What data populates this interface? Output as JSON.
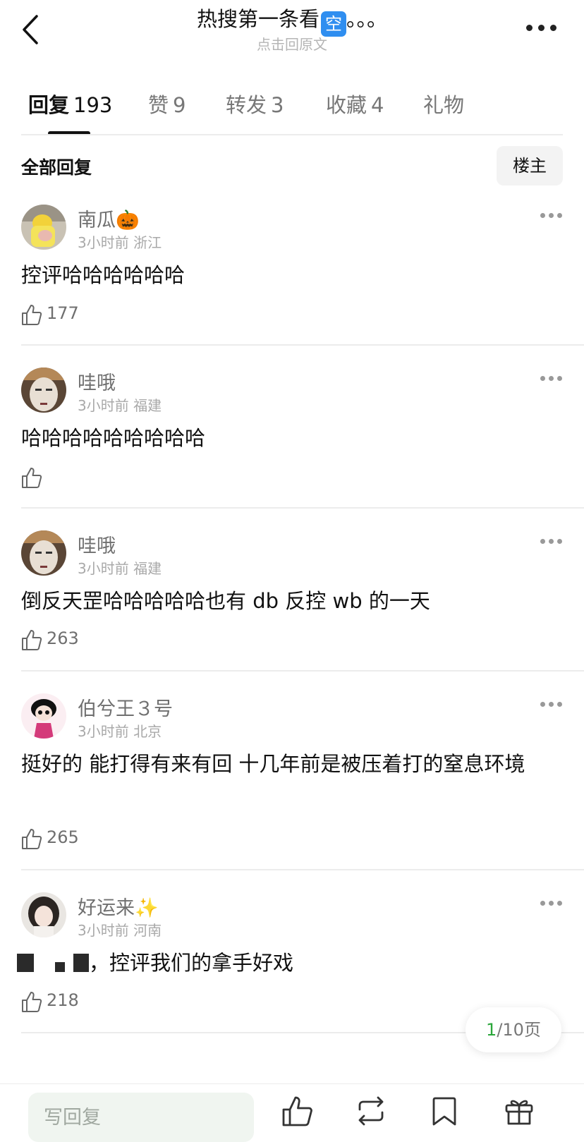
{
  "header": {
    "title": "热搜第一条看",
    "title_emoji": "空",
    "title_suffix": "。。。",
    "subtitle": "点击回原文",
    "back_icon": "chevron-left-icon",
    "more_icon": "more-horizontal-icon"
  },
  "tabs": [
    {
      "name": "回复",
      "count": "193",
      "active": true
    },
    {
      "name": "赞",
      "count": "9",
      "active": false
    },
    {
      "name": "转发",
      "count": "3",
      "active": false
    },
    {
      "name": "收藏",
      "count": "4",
      "active": false
    },
    {
      "name": "礼物",
      "count": "",
      "active": false
    }
  ],
  "filter": {
    "label": "全部回复",
    "owner_button": "楼主"
  },
  "comments": [
    {
      "username": "南瓜🎃",
      "time": "3小时前",
      "location": "浙江",
      "text": "控评哈哈哈哈哈哈",
      "likes": "177"
    },
    {
      "username": "哇哦",
      "time": "3小时前",
      "location": "福建",
      "text": "哈哈哈哈哈哈哈哈哈",
      "likes": ""
    },
    {
      "username": "哇哦",
      "time": "3小时前",
      "location": "福建",
      "text": "倒反天罡哈哈哈哈哈也有 db 反控 wb 的一天",
      "likes": "263"
    },
    {
      "username": "伯兮王３号",
      "time": "3小时前",
      "location": "北京",
      "text": "挺好的 能打得有来有回 十几年前是被压着打的窒息环境",
      "likes": "265"
    },
    {
      "username": "好运来✨",
      "time": "3小时前",
      "location": "河南",
      "text_suffix": "，控评我们的拿手好戏",
      "likes": "218"
    }
  ],
  "pagination": {
    "current": "1",
    "separator": "/",
    "total": "10页"
  },
  "bottom_bar": {
    "reply_placeholder": "写回复",
    "icons": [
      "thumbs-up-icon",
      "repost-icon",
      "bookmark-icon",
      "gift-icon"
    ]
  },
  "colors": {
    "accent_green": "#2aa63a",
    "reply_box_bg": "#f0f5f0",
    "title_emoji_bg": "#2f8ef0"
  }
}
